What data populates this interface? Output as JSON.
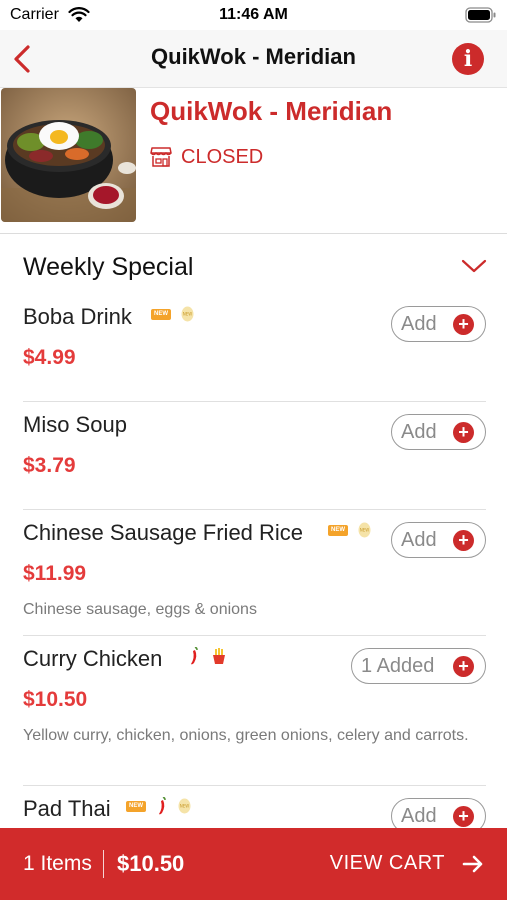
{
  "status_bar": {
    "carrier": "Carrier",
    "time": "11:46 AM"
  },
  "nav": {
    "title": "QuikWok - Meridian",
    "info_glyph": "i"
  },
  "restaurant": {
    "name": "QuikWok - Meridian",
    "status": "CLOSED",
    "status_icon": "storefront-icon"
  },
  "section": {
    "title": "Weekly Special",
    "expanded": true
  },
  "items": [
    {
      "name": "Boba Drink",
      "price": "$4.99",
      "description": "",
      "button": "Add",
      "badges": [
        "new-badge",
        "boba-icon"
      ]
    },
    {
      "name": "Miso Soup",
      "price": "$3.79",
      "description": "",
      "button": "Add",
      "badges": []
    },
    {
      "name": "Chinese Sausage Fried Rice",
      "price": "$11.99",
      "description": "Chinese sausage, eggs & onions",
      "button": "Add",
      "badges": [
        "new-badge",
        "boba-icon"
      ]
    },
    {
      "name": "Curry Chicken",
      "price": "$10.50",
      "description": "Yellow curry, chicken, onions, green onions, celery and carrots.",
      "button": "1 Added",
      "badges": [
        "chili-icon",
        "fries-icon"
      ]
    },
    {
      "name": "Pad Thai",
      "price": "",
      "description": "",
      "button": "Add",
      "badges": [
        "new-badge",
        "chili-icon",
        "boba-icon"
      ]
    }
  ],
  "new_badge_text": "NEW",
  "plus_glyph": "+",
  "cart": {
    "count": "1 Items",
    "total": "$10.50",
    "action": "VIEW CART"
  },
  "colors": {
    "brand_red": "#cc2b2b",
    "price_red": "#e43b3b",
    "cart_bar": "#d12b2b",
    "new_badge": "#f4a32a"
  }
}
